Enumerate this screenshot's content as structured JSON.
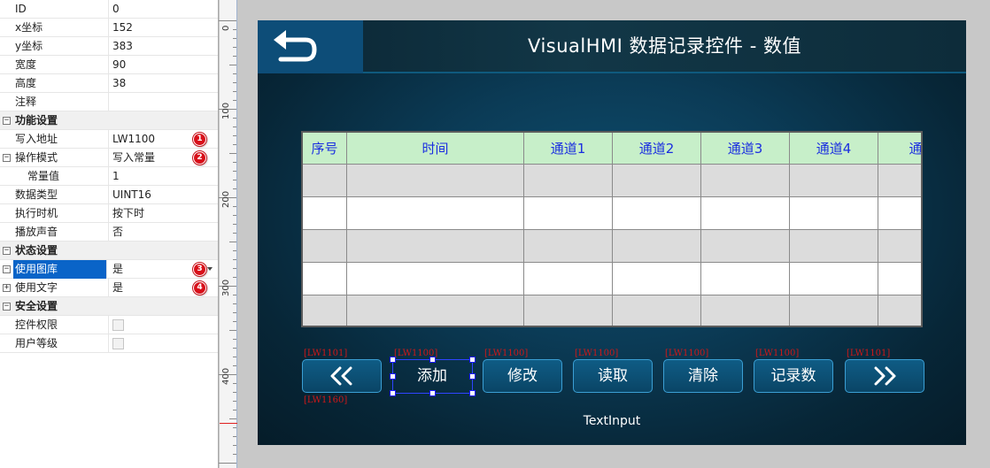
{
  "properties": [
    {
      "name": "ID",
      "value": "0"
    },
    {
      "name": "x坐标",
      "value": "152"
    },
    {
      "name": "y坐标",
      "value": "383"
    },
    {
      "name": "宽度",
      "value": "90"
    },
    {
      "name": "高度",
      "value": "38"
    },
    {
      "name": "注释",
      "value": ""
    },
    {
      "name": "功能设置",
      "category": true,
      "expander": "⊟"
    },
    {
      "name": "写入地址",
      "value": "LW1100",
      "badge": "1"
    },
    {
      "name": "操作模式",
      "value": "写入常量",
      "badge": "2",
      "expander": "⊟"
    },
    {
      "name": "常量值",
      "value": "1",
      "indent": true
    },
    {
      "name": "数据类型",
      "value": "UINT16"
    },
    {
      "name": "执行时机",
      "value": "按下时"
    },
    {
      "name": "播放声音",
      "value": "否"
    },
    {
      "name": "状态设置",
      "category": true,
      "expander": "⊟"
    },
    {
      "name": "使用图库",
      "value": "是",
      "badge": "3",
      "expander": "⊟",
      "selected": true,
      "dropdown": true
    },
    {
      "name": "使用文字",
      "value": "是",
      "badge": "4",
      "expander": "⊞"
    },
    {
      "name": "安全设置",
      "category": true,
      "expander": "⊟"
    },
    {
      "name": "控件权限",
      "checkbox": true
    },
    {
      "name": "用户等级",
      "checkbox": true
    }
  ],
  "ruler": {
    "labels": [
      "0",
      "100",
      "200",
      "300",
      "400"
    ]
  },
  "hmi": {
    "title": "VisualHMI 数据记录控件 - 数值",
    "back_icon": "return-arrow-icon",
    "table": {
      "headers": [
        "序号",
        "时间",
        "通道1",
        "通道2",
        "通道3",
        "通道4",
        "通道"
      ],
      "rows": 5
    },
    "buttons": [
      {
        "id": "prev",
        "label": "",
        "icon": "double-chevron-left-icon",
        "address": "[LW1101]"
      },
      {
        "id": "add",
        "label": "添加",
        "address": "[LW1100]",
        "selected": true
      },
      {
        "id": "edit",
        "label": "修改",
        "address": "[LW1100]"
      },
      {
        "id": "read",
        "label": "读取",
        "address": "[LW1100]"
      },
      {
        "id": "clear",
        "label": "清除",
        "address": "[LW1100]"
      },
      {
        "id": "count",
        "label": "记录数",
        "address": "[LW1100]"
      },
      {
        "id": "next",
        "label": "",
        "icon": "double-chevron-right-icon",
        "address": "[LW1101]"
      }
    ],
    "prev_address_below": "[LW1160]",
    "text_input_label": "TextInput"
  },
  "colors": {
    "header_bg": "#c7efc9",
    "header_text": "#1a2ee0",
    "address_text": "#d01818",
    "badge": "#d8101a",
    "selection": "#0a64c8"
  }
}
